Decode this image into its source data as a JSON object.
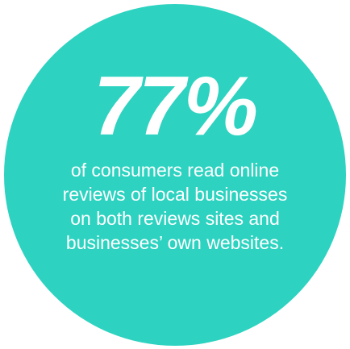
{
  "stat": {
    "figure": "77%",
    "caption_lines": [
      "of consumers read online",
      "reviews of local businesses",
      "on both reviews sites and",
      "businesses’ own websites."
    ]
  },
  "colors": {
    "circle": "#2dd3c0",
    "text": "#ffffff",
    "background": "#ffffff"
  }
}
